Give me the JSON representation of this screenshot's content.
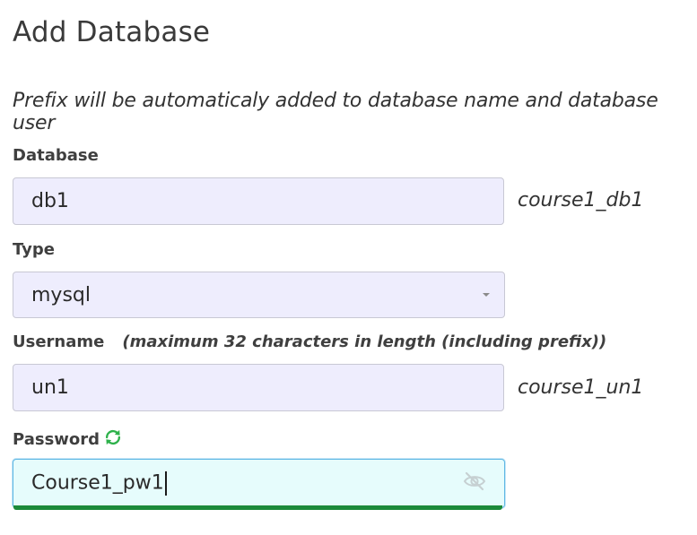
{
  "page": {
    "title": "Add Database",
    "prefix_note": "Prefix will be automaticaly added to database name and database user"
  },
  "database": {
    "label": "Database",
    "value": "db1",
    "preview": "course1_db1"
  },
  "type": {
    "label": "Type",
    "selected": "mysql"
  },
  "username": {
    "label": "Username",
    "hint": "(maximum 32 characters in length (including prefix))",
    "value": "un1",
    "preview": "course1_un1"
  },
  "password": {
    "label": "Password",
    "value": "Course1_pw1",
    "strength_color": "#1c8a3a"
  },
  "icons": {
    "refresh": "refresh-icon",
    "visibility": "eye-slash-icon",
    "select_caret": "caret-down-icon"
  },
  "colors": {
    "input_bg": "#eeedfd",
    "focused_input_bg": "#e6fcfc",
    "focus_border": "#5fb7e4",
    "refresh_icon": "#2db14a"
  }
}
